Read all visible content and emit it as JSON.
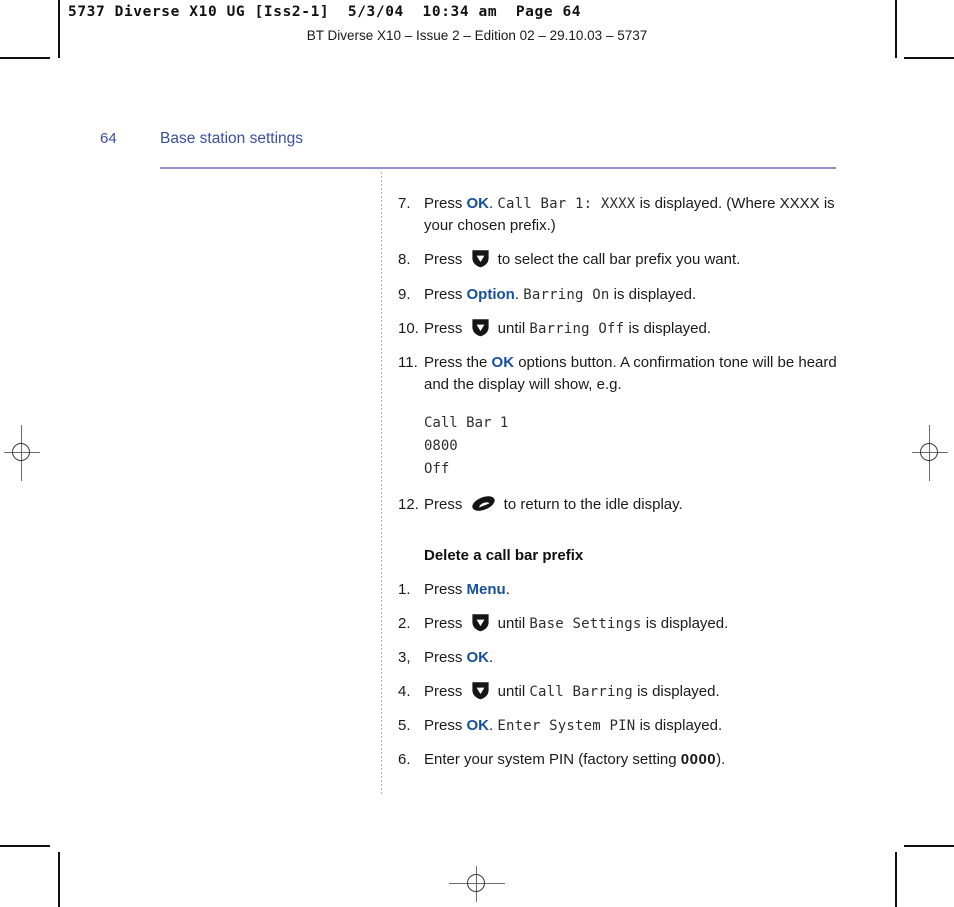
{
  "film_strip": {
    "job_line": "5737 Diverse X10 UG [Iss2-1]  5/3/04  10:34 am  Page 64",
    "edition_line": "BT Diverse X10 – Issue 2 – Edition 02 – 29.10.03 – 5737"
  },
  "page_header": {
    "folio": "64",
    "chapter_title": "Base station settings"
  },
  "colors": {
    "heading_blue": "#3b4fa0",
    "keyword_blue": "#15509e",
    "rule_purple": "#8e93c6",
    "divider_purple": "#a9aed6"
  },
  "icons": {
    "down_arrow": "down-arrow-key-icon",
    "end_call": "end-call-key-icon"
  },
  "steps_continued": [
    {
      "num": "7.",
      "parts": [
        {
          "type": "text",
          "value": "Press "
        },
        {
          "type": "keyword",
          "value": "OK"
        },
        {
          "type": "text",
          "value": ". "
        },
        {
          "type": "lcd",
          "value": "Call Bar 1: XXXX"
        },
        {
          "type": "text",
          "value": " is displayed. (Where XXXX is your chosen prefix.)"
        }
      ]
    },
    {
      "num": "8.",
      "parts": [
        {
          "type": "text",
          "value": "Press "
        },
        {
          "type": "icon",
          "value": "down-arrow-key-icon"
        },
        {
          "type": "text",
          "value": " to select the call bar prefix you want."
        }
      ]
    },
    {
      "num": "9.",
      "parts": [
        {
          "type": "text",
          "value": "Press "
        },
        {
          "type": "keyword",
          "value": "Option"
        },
        {
          "type": "text",
          "value": ". "
        },
        {
          "type": "lcd",
          "value": "Barring On"
        },
        {
          "type": "text",
          "value": " is displayed."
        }
      ]
    },
    {
      "num": "10.",
      "parts": [
        {
          "type": "text",
          "value": "Press "
        },
        {
          "type": "icon",
          "value": "down-arrow-key-icon"
        },
        {
          "type": "text",
          "value": " until "
        },
        {
          "type": "lcd",
          "value": "Barring Off"
        },
        {
          "type": "text",
          "value": " is displayed."
        }
      ]
    },
    {
      "num": "11.",
      "parts": [
        {
          "type": "text",
          "value": "Press the "
        },
        {
          "type": "keyword",
          "value": "OK"
        },
        {
          "type": "text",
          "value": " options button. A confirmation tone will be heard and the display will show, e.g."
        }
      ]
    }
  ],
  "display_sample": {
    "lines": [
      "Call Bar 1",
      "0800",
      "Off"
    ]
  },
  "step_twelve": {
    "num": "12.",
    "parts": [
      {
        "type": "text",
        "value": "Press "
      },
      {
        "type": "icon",
        "value": "end-call-key-icon"
      },
      {
        "type": "text",
        "value": " to return to the idle display."
      }
    ]
  },
  "section": {
    "heading": "Delete a call bar prefix",
    "steps": [
      {
        "num": "1.",
        "parts": [
          {
            "type": "text",
            "value": "Press "
          },
          {
            "type": "keyword",
            "value": "Menu"
          },
          {
            "type": "text",
            "value": "."
          }
        ]
      },
      {
        "num": "2.",
        "parts": [
          {
            "type": "text",
            "value": "Press "
          },
          {
            "type": "icon",
            "value": "down-arrow-key-icon"
          },
          {
            "type": "text",
            "value": " until "
          },
          {
            "type": "lcd",
            "value": "Base Settings"
          },
          {
            "type": "text",
            "value": " is displayed."
          }
        ]
      },
      {
        "num": "3,",
        "parts": [
          {
            "type": "text",
            "value": "Press "
          },
          {
            "type": "keyword",
            "value": "OK"
          },
          {
            "type": "text",
            "value": "."
          }
        ]
      },
      {
        "num": "4.",
        "parts": [
          {
            "type": "text",
            "value": "Press "
          },
          {
            "type": "icon",
            "value": "down-arrow-key-icon"
          },
          {
            "type": "text",
            "value": " until "
          },
          {
            "type": "lcd",
            "value": "Call Barring"
          },
          {
            "type": "text",
            "value": " is displayed."
          }
        ]
      },
      {
        "num": "5.",
        "parts": [
          {
            "type": "text",
            "value": "Press "
          },
          {
            "type": "keyword",
            "value": "OK"
          },
          {
            "type": "text",
            "value": ". "
          },
          {
            "type": "lcd",
            "value": "Enter System PIN"
          },
          {
            "type": "text",
            "value": " is displayed."
          }
        ]
      },
      {
        "num": "6.",
        "parts": [
          {
            "type": "text",
            "value": "Enter your system PIN (factory setting "
          },
          {
            "type": "bold",
            "value": "0000"
          },
          {
            "type": "text",
            "value": ")."
          }
        ]
      }
    ]
  }
}
